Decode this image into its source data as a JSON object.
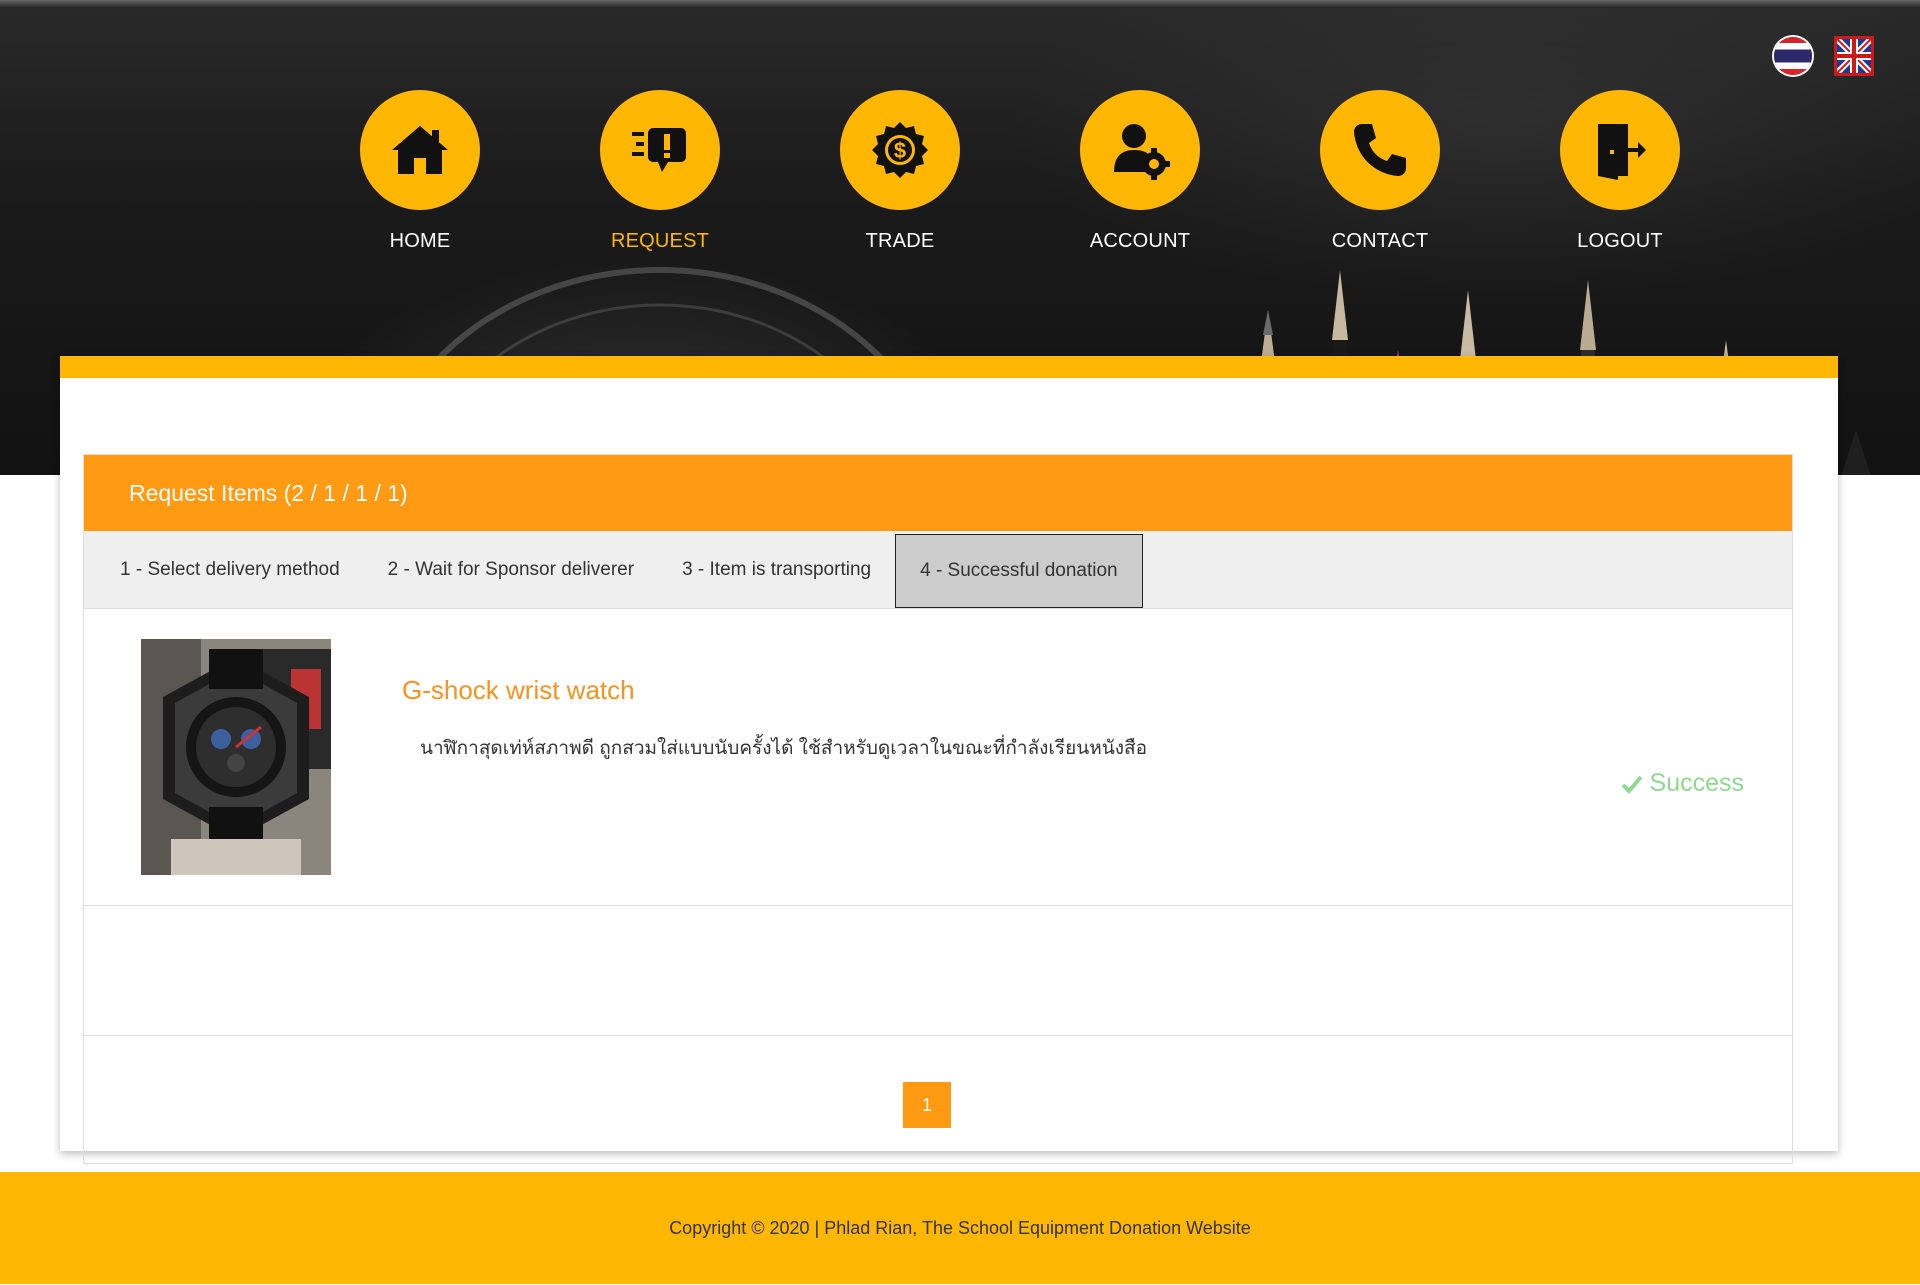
{
  "header": {
    "nav": [
      {
        "label": "HOME",
        "icon": "home-icon",
        "active": false
      },
      {
        "label": "REQUEST",
        "icon": "request-icon",
        "active": true
      },
      {
        "label": "TRADE",
        "icon": "dollar-badge-icon",
        "active": false
      },
      {
        "label": "ACCOUNT",
        "icon": "user-settings-icon",
        "active": false
      },
      {
        "label": "CONTACT",
        "icon": "phone-icon",
        "active": false
      },
      {
        "label": "LOGOUT",
        "icon": "logout-door-icon",
        "active": false
      }
    ],
    "languages": [
      {
        "name": "thai-flag-icon"
      },
      {
        "name": "uk-flag-icon",
        "selected": true
      }
    ]
  },
  "panel": {
    "title": "Request Items (2 / 1 / 1 / 1)",
    "tabs": [
      {
        "label": "1 - Select delivery method",
        "active": false
      },
      {
        "label": "2 - Wait for Sponsor deliverer",
        "active": false
      },
      {
        "label": "3 - Item is transporting",
        "active": false
      },
      {
        "label": "4 - Successful donation",
        "active": true
      }
    ],
    "items": [
      {
        "title": "G-shock wrist watch",
        "description": "นาฬิกาสุดเท่ห์สภาพดี ถูกสวมใส่แบบนับครั้งได้ ใช้สำหรับดูเวลาในขณะที่กำลังเรียนหนังสือ",
        "status": "Success",
        "image": "watch-photo"
      }
    ],
    "pagination": {
      "current": "1"
    }
  },
  "footer": {
    "copyright": "Copyright © 2020 | Phlad Rian, The School Equipment Donation Website"
  },
  "colors": {
    "accent": "#ffb703",
    "panel_header": "#ff9a12",
    "item_title": "#f7921e",
    "success": "#8ed98e"
  }
}
